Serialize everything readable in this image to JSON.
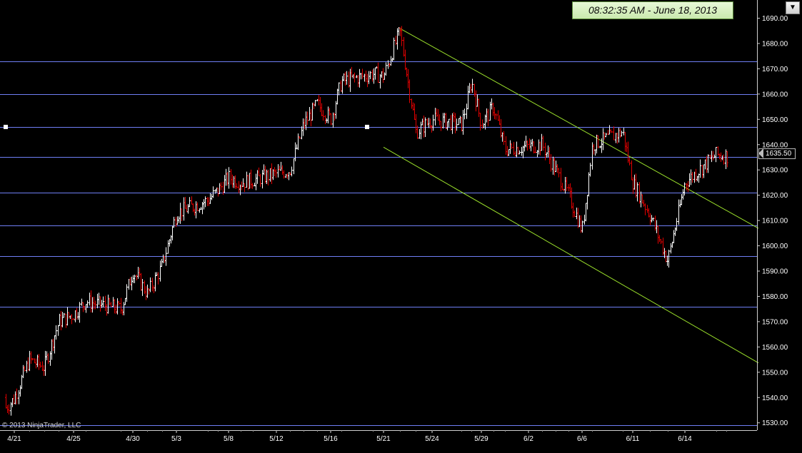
{
  "header": {
    "timestamp": "08:32:35 AM - June 18, 2013",
    "dropdown_icon": "chevron-down-icon"
  },
  "footer": {
    "copyright": "© 2013 NinjaTrader, LLC"
  },
  "last_price_label": "1635.50",
  "colors": {
    "background": "#000000",
    "up_bar": "#ffffff",
    "down_bar": "#e00000",
    "horizontal_line": "#6f7ff5",
    "channel_line": "#9be02b",
    "axis_text": "#ffffff"
  },
  "chart_data": {
    "type": "bar",
    "title": "",
    "xlabel": "",
    "ylabel": "",
    "ylim": [
      1526,
      1693
    ],
    "y_ticks": [
      "1530.00",
      "1540.00",
      "1550.00",
      "1560.00",
      "1570.00",
      "1580.00",
      "1590.00",
      "1600.00",
      "1610.00",
      "1620.00",
      "1630.00",
      "1640.00",
      "1650.00",
      "1660.00",
      "1670.00",
      "1680.00",
      "1690.00"
    ],
    "x_ticks": [
      "4/21",
      "4/25",
      "4/30",
      "5/3",
      "5/8",
      "5/12",
      "5/16",
      "5/21",
      "5/24",
      "5/29",
      "6/2",
      "6/6",
      "6/11",
      "6/14"
    ],
    "x_range": [
      "4/21",
      "6/18"
    ],
    "last_price": 1635.5,
    "horizontal_levels": [
      1529,
      1576,
      1596,
      1608,
      1621,
      1635,
      1647,
      1660,
      1673
    ],
    "channel": {
      "upper": [
        {
          "x": "5/22",
          "y": 1686
        },
        {
          "x": "6/18",
          "y": 1614
        }
      ],
      "lower": [
        {
          "x": "5/21",
          "y": 1639
        },
        {
          "x": "6/18",
          "y": 1561
        }
      ]
    },
    "price_path": [
      [
        "4/21",
        1540
      ],
      [
        "4/22",
        1555
      ],
      [
        "4/23",
        1552
      ],
      [
        "4/24",
        1570
      ],
      [
        "4/25",
        1573
      ],
      [
        "4/26",
        1578
      ],
      [
        "4/29",
        1575
      ],
      [
        "4/30",
        1590
      ],
      [
        "5/1",
        1581
      ],
      [
        "5/2",
        1592
      ],
      [
        "5/3",
        1613
      ],
      [
        "5/6",
        1618
      ],
      [
        "5/7",
        1622
      ],
      [
        "5/8",
        1627
      ],
      [
        "5/9",
        1625
      ],
      [
        "5/10",
        1626
      ],
      [
        "5/13",
        1630
      ],
      [
        "5/14",
        1648
      ],
      [
        "5/15",
        1656
      ],
      [
        "5/16",
        1650
      ],
      [
        "5/17",
        1665
      ],
      [
        "5/20",
        1668
      ],
      [
        "5/21",
        1667
      ],
      [
        "5/22",
        1685
      ],
      [
        "5/23",
        1645
      ],
      [
        "5/24",
        1650
      ],
      [
        "5/27",
        1648
      ],
      [
        "5/28",
        1665
      ],
      [
        "5/29",
        1648
      ],
      [
        "5/30",
        1655
      ],
      [
        "5/31",
        1638
      ],
      [
        "6/3",
        1640
      ],
      [
        "6/4",
        1630
      ],
      [
        "6/5",
        1620
      ],
      [
        "6/6",
        1606
      ],
      [
        "6/7",
        1640
      ],
      [
        "6/10",
        1645
      ],
      [
        "6/11",
        1625
      ],
      [
        "6/12",
        1612
      ],
      [
        "6/13",
        1594
      ],
      [
        "6/14",
        1625
      ],
      [
        "6/17",
        1636
      ],
      [
        "6/18",
        1635.5
      ]
    ]
  }
}
